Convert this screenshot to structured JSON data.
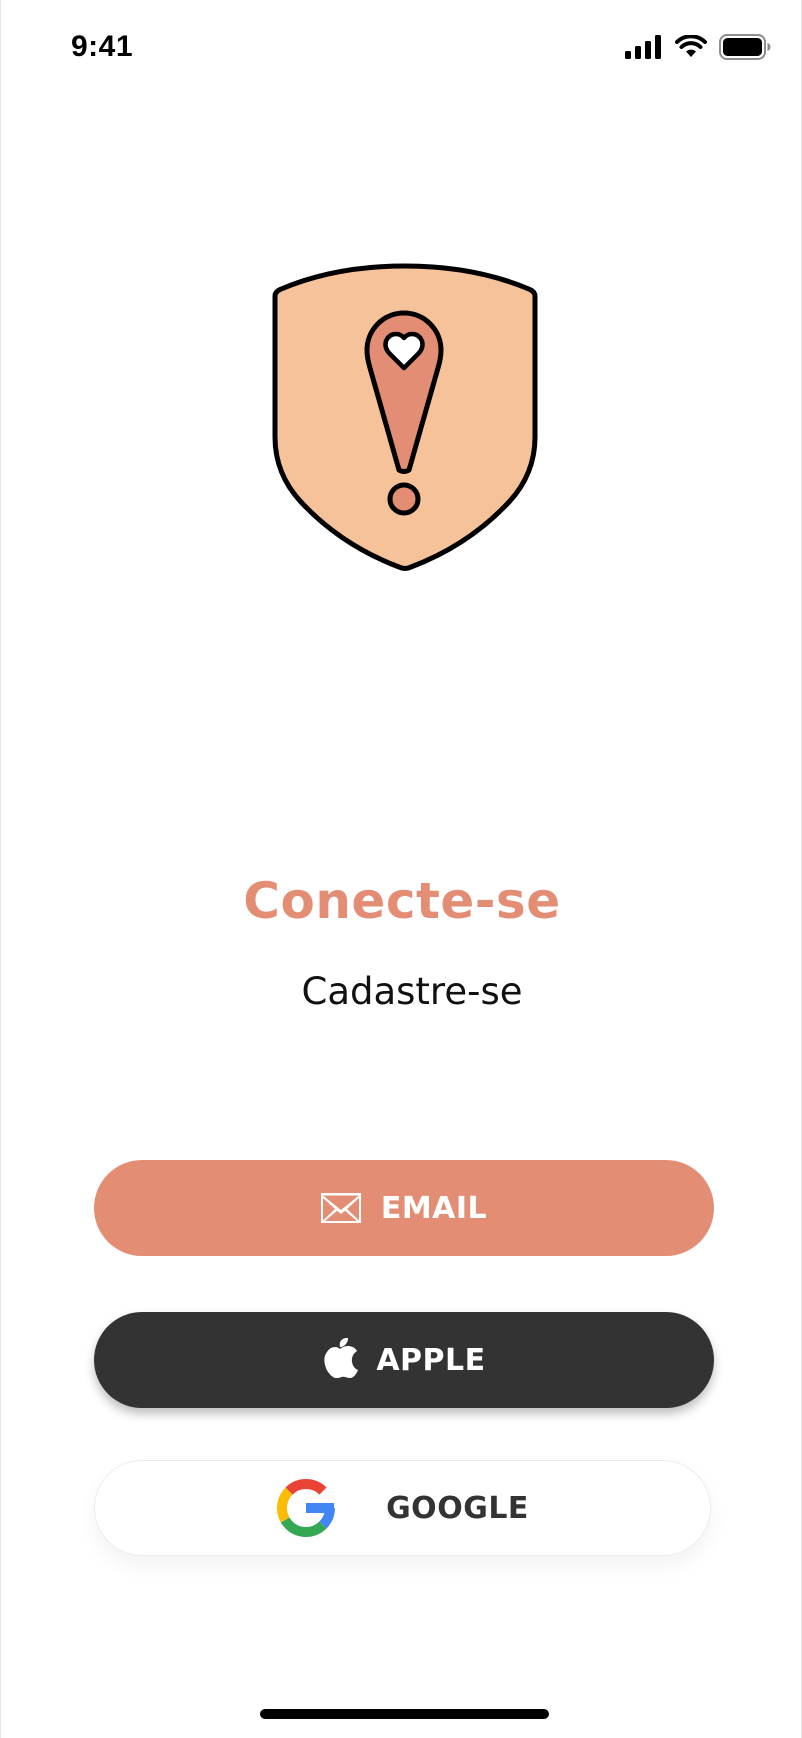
{
  "status_bar": {
    "time": "9:41",
    "icons": [
      "cellular-signal-icon",
      "wifi-icon",
      "battery-icon"
    ]
  },
  "logo": {
    "icon": "shield-location-pin-heart-icon",
    "colors": {
      "shield_fill": "#f5c29a",
      "pin_fill": "#e38e74",
      "outline": "#000000"
    }
  },
  "main": {
    "title": "Conecte-se",
    "subtitle": "Cadastre-se"
  },
  "buttons": {
    "email": {
      "label": "EMAIL",
      "icon": "envelope-icon",
      "background": "#e38e74"
    },
    "apple": {
      "label": "APPLE",
      "icon": "apple-logo-icon",
      "background": "#333333"
    },
    "google": {
      "label": "GOOGLE",
      "icon": "google-logo-icon",
      "background": "#ffffff"
    }
  },
  "colors": {
    "accent": "#e38e74",
    "dark": "#333333"
  }
}
